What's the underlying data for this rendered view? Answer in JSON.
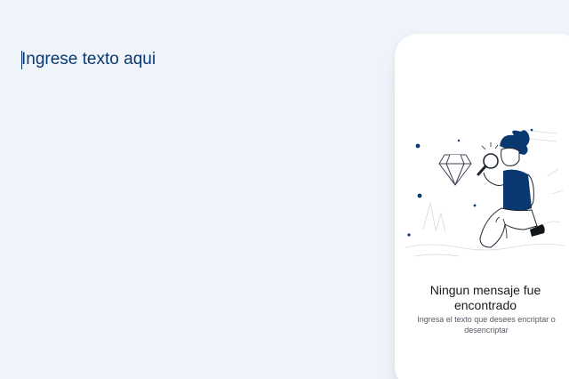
{
  "input": {
    "placeholder": "Ingrese texto aqui",
    "value": ""
  },
  "output": {
    "empty_title": "Ningun mensaje fue encontrado",
    "empty_description": "Ingresa el texto que desees encriptar o desencriptar",
    "illustration_icon": "person-with-magnifier-and-diamond"
  },
  "colors": {
    "background": "#eff3fa",
    "accent": "#0a3871",
    "panel": "#ffffff"
  }
}
